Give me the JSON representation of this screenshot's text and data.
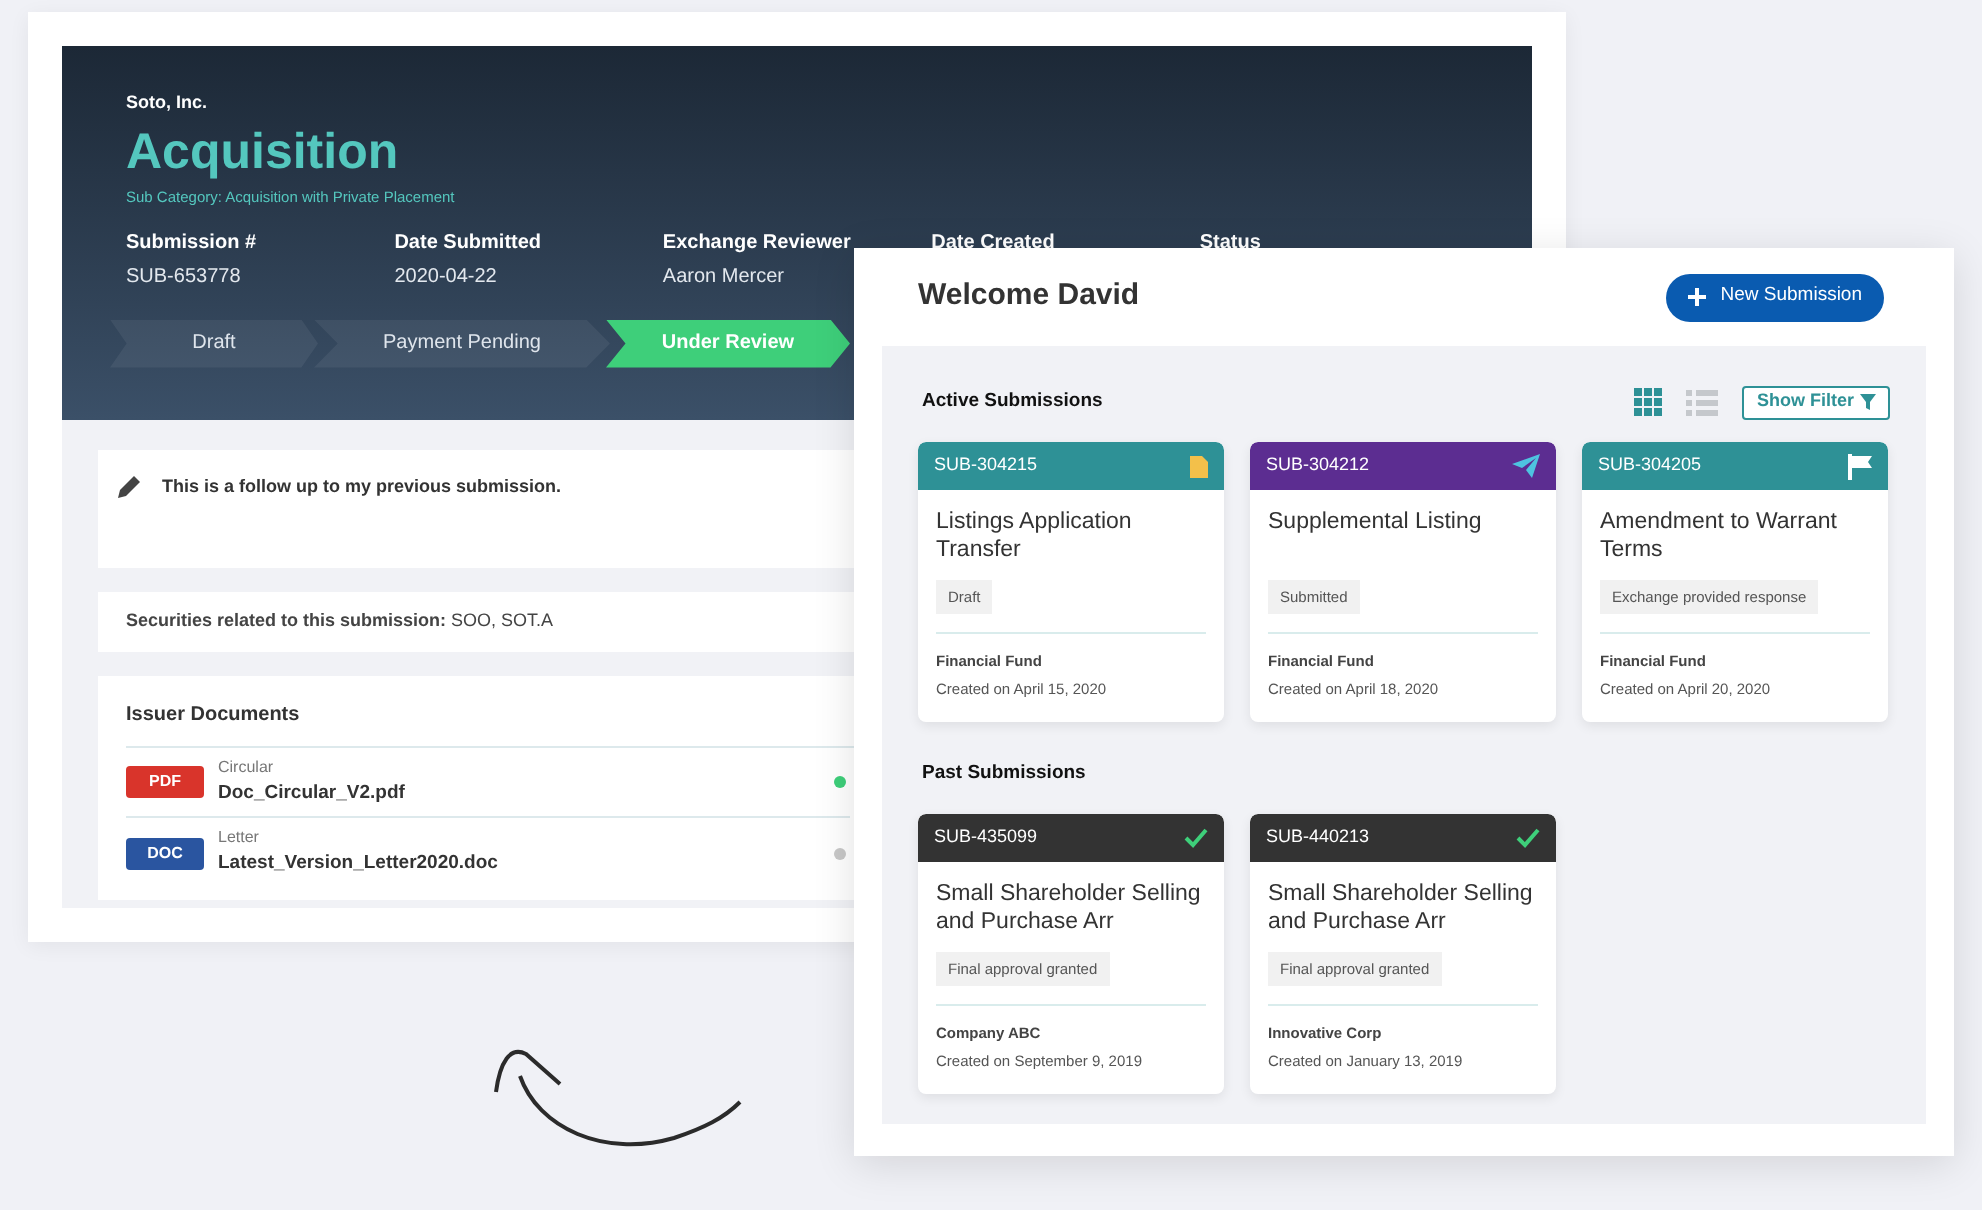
{
  "submission": {
    "company": "Soto, Inc.",
    "title": "Acquisition",
    "sub_category": "Sub Category: Acquisition with Private Placement",
    "fields": [
      {
        "label": "Submission #",
        "value": "SUB-653778"
      },
      {
        "label": "Date Submitted",
        "value": "2020-04-22"
      },
      {
        "label": "Exchange Reviewer",
        "value": "Aaron Mercer"
      },
      {
        "label": "Date Created"
      },
      {
        "label": "Status"
      }
    ],
    "steps": [
      {
        "label": "Draft",
        "selected": false
      },
      {
        "label": "Payment Pending",
        "selected": false
      },
      {
        "label": "Under Review",
        "selected": true
      }
    ],
    "note": "This is a follow up to my previous submission.",
    "securities": "**Securities related to this submission:** SOO, SOT.A",
    "documents_title": "Issuer Documents",
    "documents": [
      {
        "type": "PDF",
        "kind": "pdf",
        "category": "Circular",
        "file": "Doc_Circular_V2.pdf",
        "color": "#3ecf7a"
      },
      {
        "type": "DOC",
        "kind": "doc",
        "category": "Letter",
        "file": "Latest_Version_Letter2020.doc",
        "color": "#c8c8c8"
      }
    ]
  },
  "dashboard": {
    "welcome": "Welcome David",
    "new_button": "New Submission",
    "filter_button": "Show Filter",
    "sections": [
      {
        "title": "Active Submissions",
        "cards": [
          {
            "id": "SUB-304215",
            "color": "#2e9196",
            "kind": "file",
            "title": "Listings Application Transfer",
            "status": "Draft",
            "company": "Financial Fund",
            "created": "Created on April 15, 2020"
          },
          {
            "id": "SUB-304212",
            "color": "#5c2d91",
            "kind": "plane",
            "title": "Supplemental Listing",
            "status": "Submitted",
            "company": "Financial Fund",
            "created": "Created on April 18, 2020"
          },
          {
            "id": "SUB-304205",
            "color": "#2e9196",
            "kind": "flag",
            "title": "Amendment to Warrant Terms",
            "status": "Exchange provided response",
            "company": "Financial Fund",
            "created": "Created on April 20, 2020"
          }
        ]
      },
      {
        "title": "Past Submissions",
        "cards": [
          {
            "id": "SUB-435099",
            "color": "#333333",
            "kind": "check",
            "title": "Small Shareholder Selling and Purchase Arr",
            "status": "Final approval granted",
            "company": "Company ABC",
            "created": "Created on September 9, 2019"
          },
          {
            "id": "SUB-440213",
            "color": "#333333",
            "kind": "check",
            "title": "Small Shareholder Selling and Purchase Arr",
            "status": "Final approval granted",
            "company": "Innovative Corp",
            "created": "Created on January 13, 2019"
          }
        ]
      }
    ]
  }
}
